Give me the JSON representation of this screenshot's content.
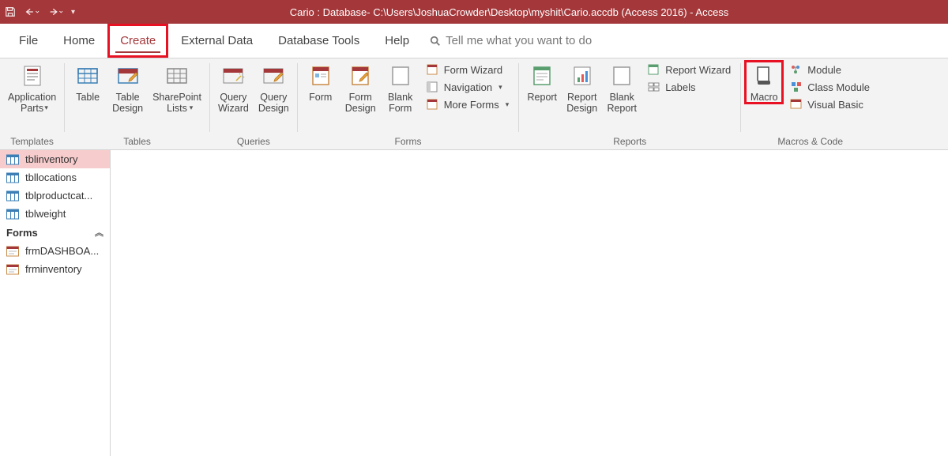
{
  "titleBar": {
    "title": "Cario : Database- C:\\Users\\JoshuaCrowder\\Desktop\\myshit\\Cario.accdb (Access 2016)  -  Access"
  },
  "tabs": {
    "file": "File",
    "home": "Home",
    "create": "Create",
    "externalData": "External Data",
    "databaseTools": "Database Tools",
    "help": "Help",
    "tellMe": "Tell me what you want to do"
  },
  "ribbon": {
    "templates": {
      "label": "Templates",
      "applicationParts": "Application\nParts"
    },
    "tables": {
      "label": "Tables",
      "table": "Table",
      "tableDesign": "Table\nDesign",
      "sharepointLists": "SharePoint\nLists"
    },
    "queries": {
      "label": "Queries",
      "queryWizard": "Query\nWizard",
      "queryDesign": "Query\nDesign"
    },
    "forms": {
      "label": "Forms",
      "form": "Form",
      "formDesign": "Form\nDesign",
      "blankForm": "Blank\nForm",
      "formWizard": "Form Wizard",
      "navigation": "Navigation",
      "moreForms": "More Forms"
    },
    "reports": {
      "label": "Reports",
      "report": "Report",
      "reportDesign": "Report\nDesign",
      "blankReport": "Blank\nReport",
      "reportWizard": "Report Wizard",
      "labels": "Labels"
    },
    "macrosCode": {
      "label": "Macros & Code",
      "macro": "Macro",
      "module": "Module",
      "classModule": "Class Module",
      "visualBasic": "Visual Basic"
    }
  },
  "navPane": {
    "formsHeader": "Forms",
    "tables": [
      "tblinventory",
      "tbllocations",
      "tblproductcat...",
      "tblweight"
    ],
    "forms": [
      "frmDASHBOA...",
      "frminventory"
    ]
  }
}
